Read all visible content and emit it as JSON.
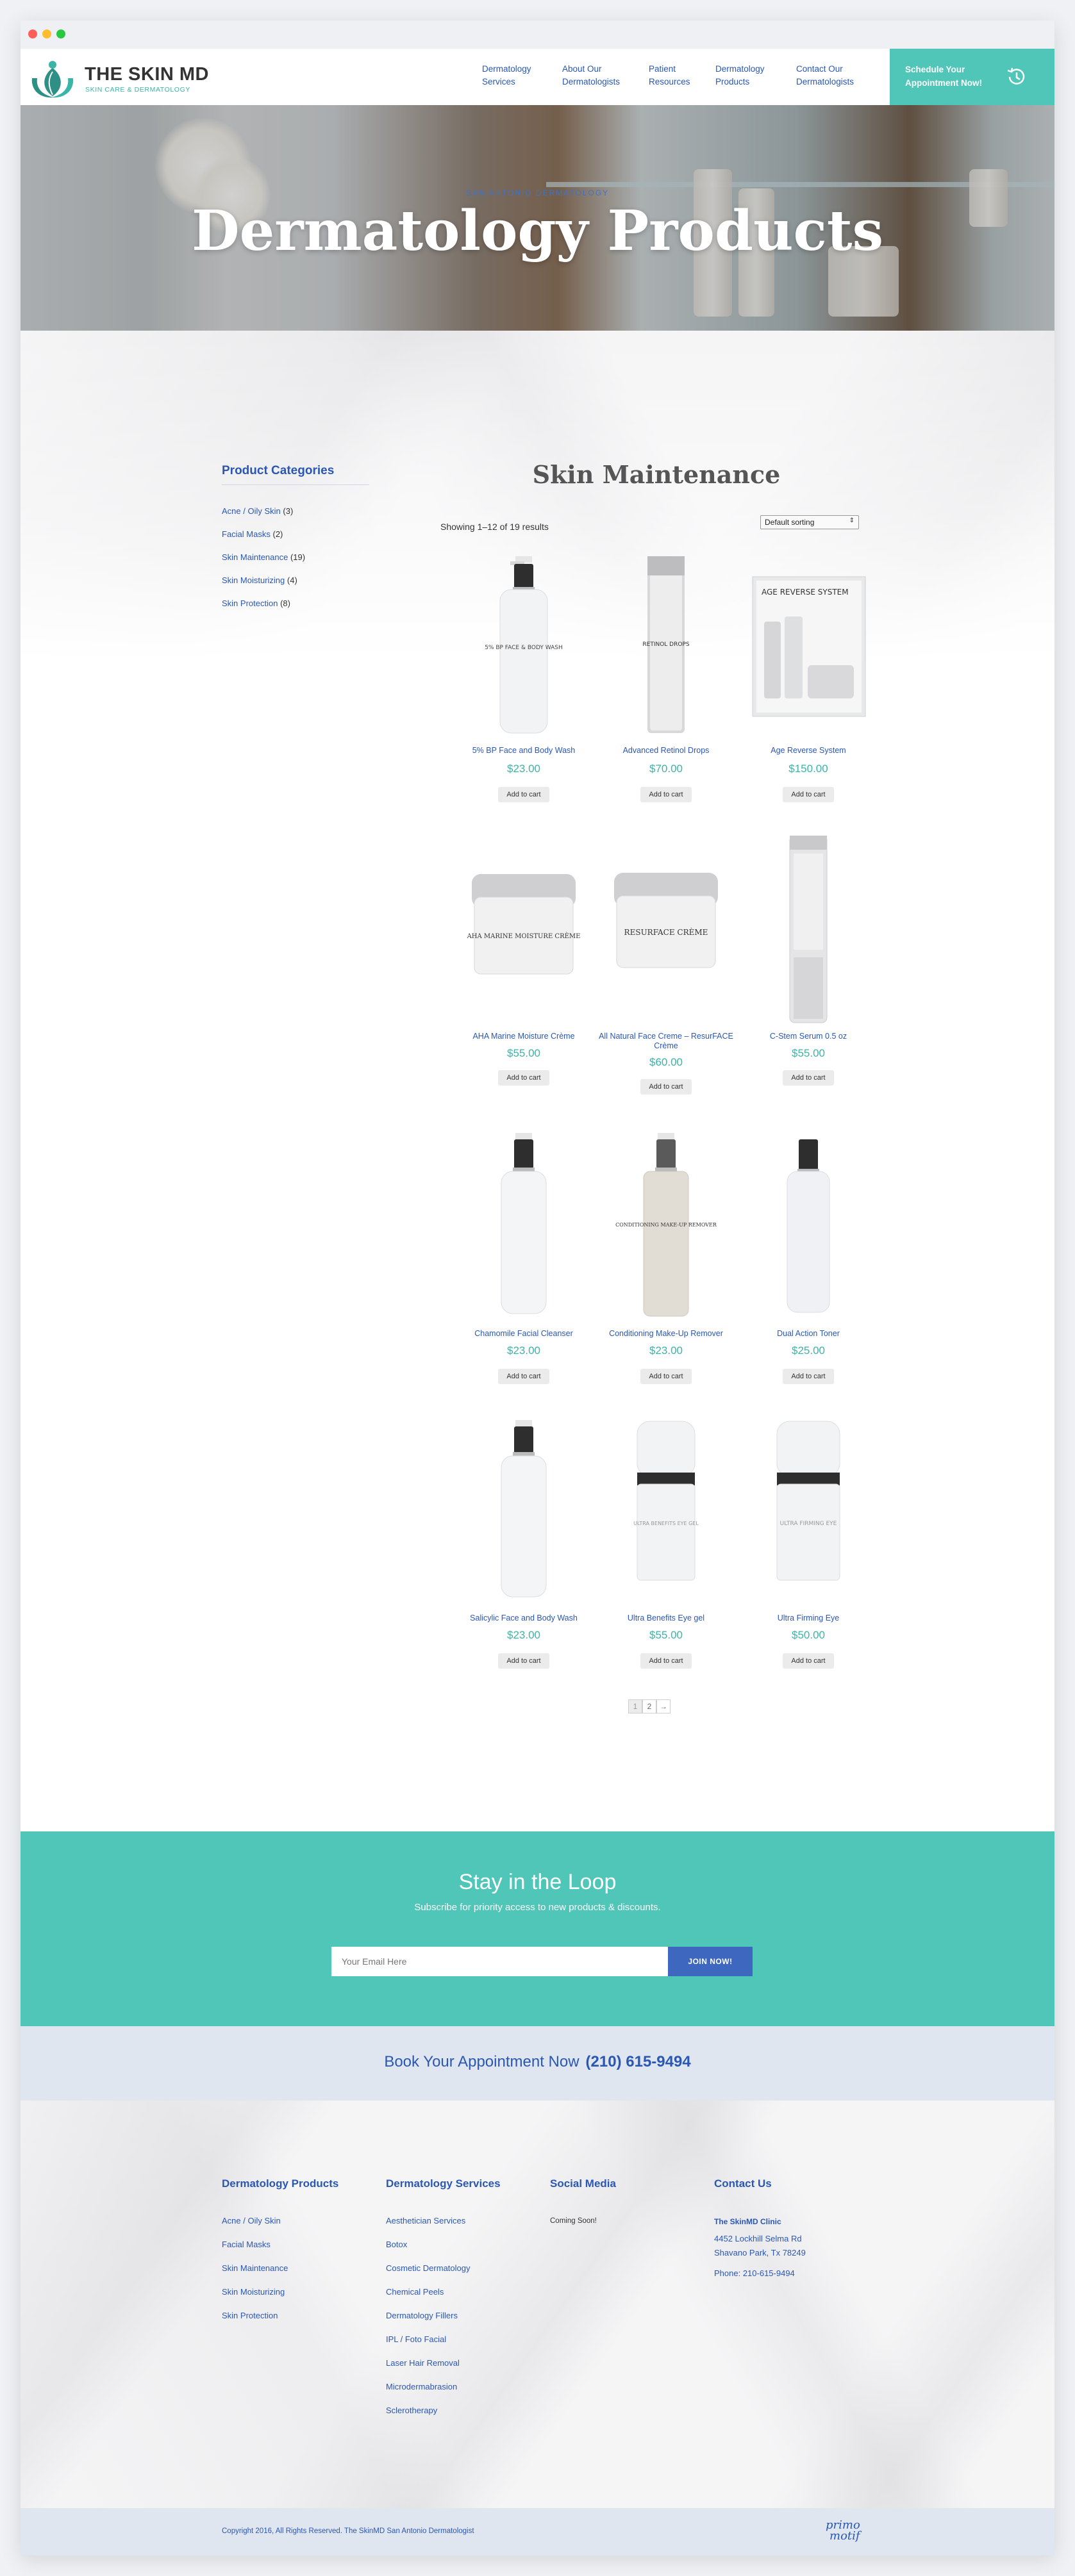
{
  "window": {
    "controls": [
      "close",
      "minimize",
      "zoom"
    ]
  },
  "header": {
    "brand": "THE SKIN MD",
    "tagline": "SKIN CARE & DERMATOLOGY",
    "nav": [
      {
        "line1": "Dermatology",
        "line2": "Services"
      },
      {
        "line1": "About Our",
        "line2": "Dermatologists"
      },
      {
        "line1": "Patient",
        "line2": "Resources"
      },
      {
        "line1": "Dermatology",
        "line2": "Products"
      },
      {
        "line1": "Contact Our",
        "line2": "Dermatologists"
      }
    ],
    "schedule": {
      "line1": "Schedule Your",
      "line2": "Appointment Now!",
      "icon": "history-clock-icon"
    }
  },
  "hero": {
    "kicker": "SAN ANTONIO DERMATOLOGY",
    "title": "Dermatology Products"
  },
  "sidebar": {
    "title": "Product Categories",
    "categories": [
      {
        "label": "Acne / Oily Skin",
        "count": "(3)"
      },
      {
        "label": "Facial Masks",
        "count": "(2)"
      },
      {
        "label": "Skin Maintenance",
        "count": "(19)"
      },
      {
        "label": "Skin Moisturizing",
        "count": "(4)"
      },
      {
        "label": "Skin Protection",
        "count": "(8)"
      }
    ]
  },
  "shop": {
    "title": "Skin Maintenance",
    "result_count": "Showing 1–12 of 19 results",
    "sort_selected": "Default sorting",
    "add_to_cart": "Add to cart",
    "products": [
      {
        "name": "5% BP Face and Body Wash",
        "price": "$23.00",
        "label": "5% BP FACE & BODY WASH"
      },
      {
        "name": "Advanced Retinol Drops",
        "price": "$70.00",
        "label": "RETINOL DROPS"
      },
      {
        "name": "Age Reverse System",
        "price": "$150.00",
        "label": "AGE REVERSE SYSTEM"
      },
      {
        "name": "AHA Marine Moisture Crème",
        "price": "$55.00",
        "label": "AHA MARINE MOISTURE CRÈME"
      },
      {
        "name": "All Natural Face Creme – ResurFACE Crème",
        "price": "$60.00",
        "label": "RESURFACE CRÈME"
      },
      {
        "name": "C-Stem Serum 0.5 oz",
        "price": "$55.00",
        "label": ""
      },
      {
        "name": "Chamomile Facial Cleanser",
        "price": "$23.00",
        "label": ""
      },
      {
        "name": "Conditioning Make-Up Remover",
        "price": "$23.00",
        "label": "CONDITIONING MAKE-UP REMOVER"
      },
      {
        "name": "Dual Action Toner",
        "price": "$25.00",
        "label": ""
      },
      {
        "name": "Salicylic Face and Body Wash",
        "price": "$23.00",
        "label": ""
      },
      {
        "name": "Ultra Benefits Eye gel",
        "price": "$55.00",
        "label": "ULTRA BENEFITS EYE GEL"
      },
      {
        "name": "Ultra Firming Eye",
        "price": "$50.00",
        "label": "ULTRA FIRMING EYE"
      }
    ],
    "pagination": [
      "1",
      "2",
      "→"
    ]
  },
  "newsletter": {
    "title": "Stay in the Loop",
    "subtitle": "Subscribe for priority access to new products & discounts.",
    "placeholder": "Your Email Here",
    "button": "JOIN NOW!"
  },
  "appointment": {
    "text": "Book Your Appointment Now",
    "phone": "(210) 615-9494"
  },
  "footer": {
    "products": {
      "title": "Dermatology Products",
      "items": [
        "Acne / Oily Skin",
        "Facial Masks",
        "Skin Maintenance",
        "Skin Moisturizing",
        "Skin Protection"
      ]
    },
    "services": {
      "title": "Dermatology Services",
      "items": [
        "Aesthetician Services",
        "Botox",
        "Cosmetic Dermatology",
        "Chemical Peels",
        "Dermatology Fillers",
        "IPL / Foto Facial",
        "Laser Hair Removal",
        "Microdermabrasion",
        "Sclerotherapy"
      ]
    },
    "social": {
      "title": "Social Media",
      "text": "Coming Soon!"
    },
    "contact": {
      "title": "Contact Us",
      "clinic": "The SkinMD Clinic",
      "address1": "4452 Lockhill Selma Rd",
      "address2": "Shavano Park, Tx 78249",
      "phone": "Phone: 210-615-9494"
    },
    "copyright": "Copyright 2016, All Rights Reserved. The SkinMD San Antonio Dermatologist",
    "credit_line1": "primo",
    "credit_line2": "motif"
  },
  "colors": {
    "teal": "#4fc6b8",
    "blue": "#2a57b5",
    "button_blue": "#3e67c0",
    "price_teal": "#3ab5a8"
  }
}
